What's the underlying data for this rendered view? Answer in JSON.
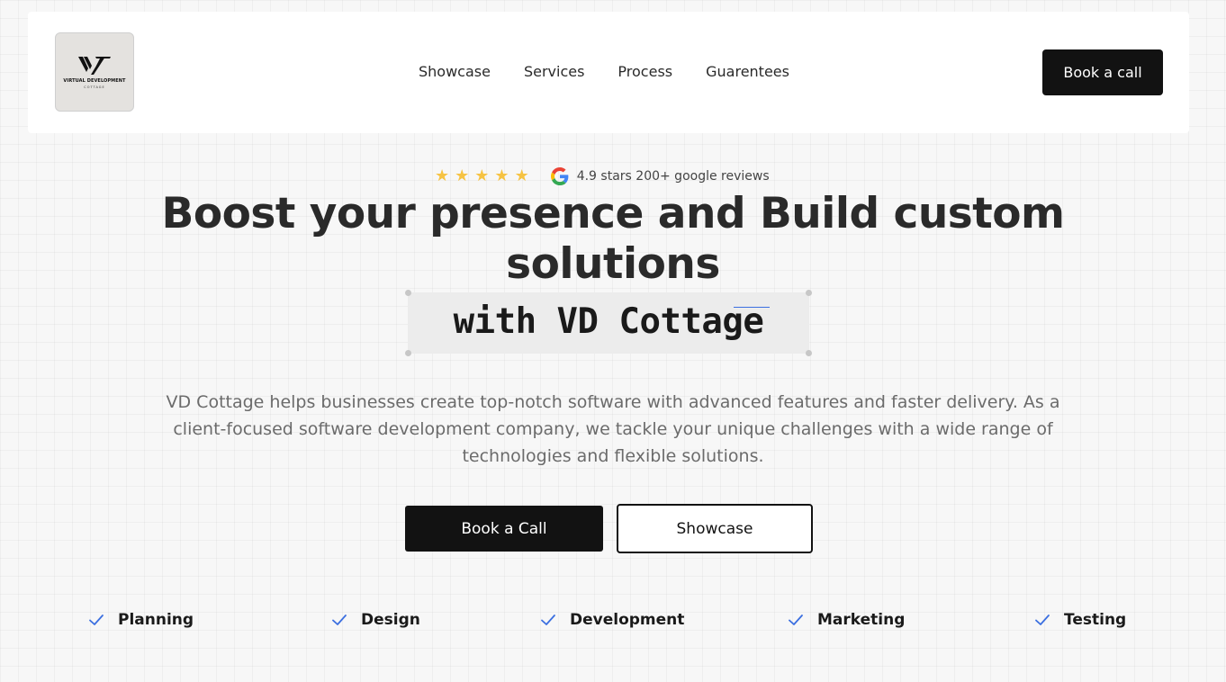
{
  "header": {
    "logo": {
      "name": "VIRTUAL DEVELOPMENT",
      "subtitle": "COTTAGE"
    },
    "nav": [
      {
        "label": "Showcase"
      },
      {
        "label": "Services"
      },
      {
        "label": "Process"
      },
      {
        "label": "Guarentees"
      }
    ],
    "cta_label": "Book a call"
  },
  "hero": {
    "rating": {
      "star_count": 5,
      "star_icon": "star-icon",
      "review_icon": "google-icon",
      "text": "4.9 stars 200+ google reviews"
    },
    "title_line1": "Boost your presence and Build custom",
    "title_line2": "solutions",
    "highlight": "with VD Cottage",
    "description": "VD Cottage helps businesses create top-notch software with advanced features and faster delivery. As a client-focused software development company, we tackle your unique challenges with a wide range of technologies and flexible solutions.",
    "primary_cta": "Book a Call",
    "secondary_cta": "Showcase"
  },
  "features": [
    {
      "label": "Planning",
      "icon": "check-icon"
    },
    {
      "label": "Design",
      "icon": "check-icon"
    },
    {
      "label": "Development",
      "icon": "check-icon"
    },
    {
      "label": "Marketing",
      "icon": "check-icon"
    },
    {
      "label": "Testing",
      "icon": "check-icon"
    }
  ],
  "colors": {
    "accent": "#3b6fe0",
    "star": "#f6c343",
    "button_dark": "#121212",
    "text_muted": "#6b6b6b"
  }
}
